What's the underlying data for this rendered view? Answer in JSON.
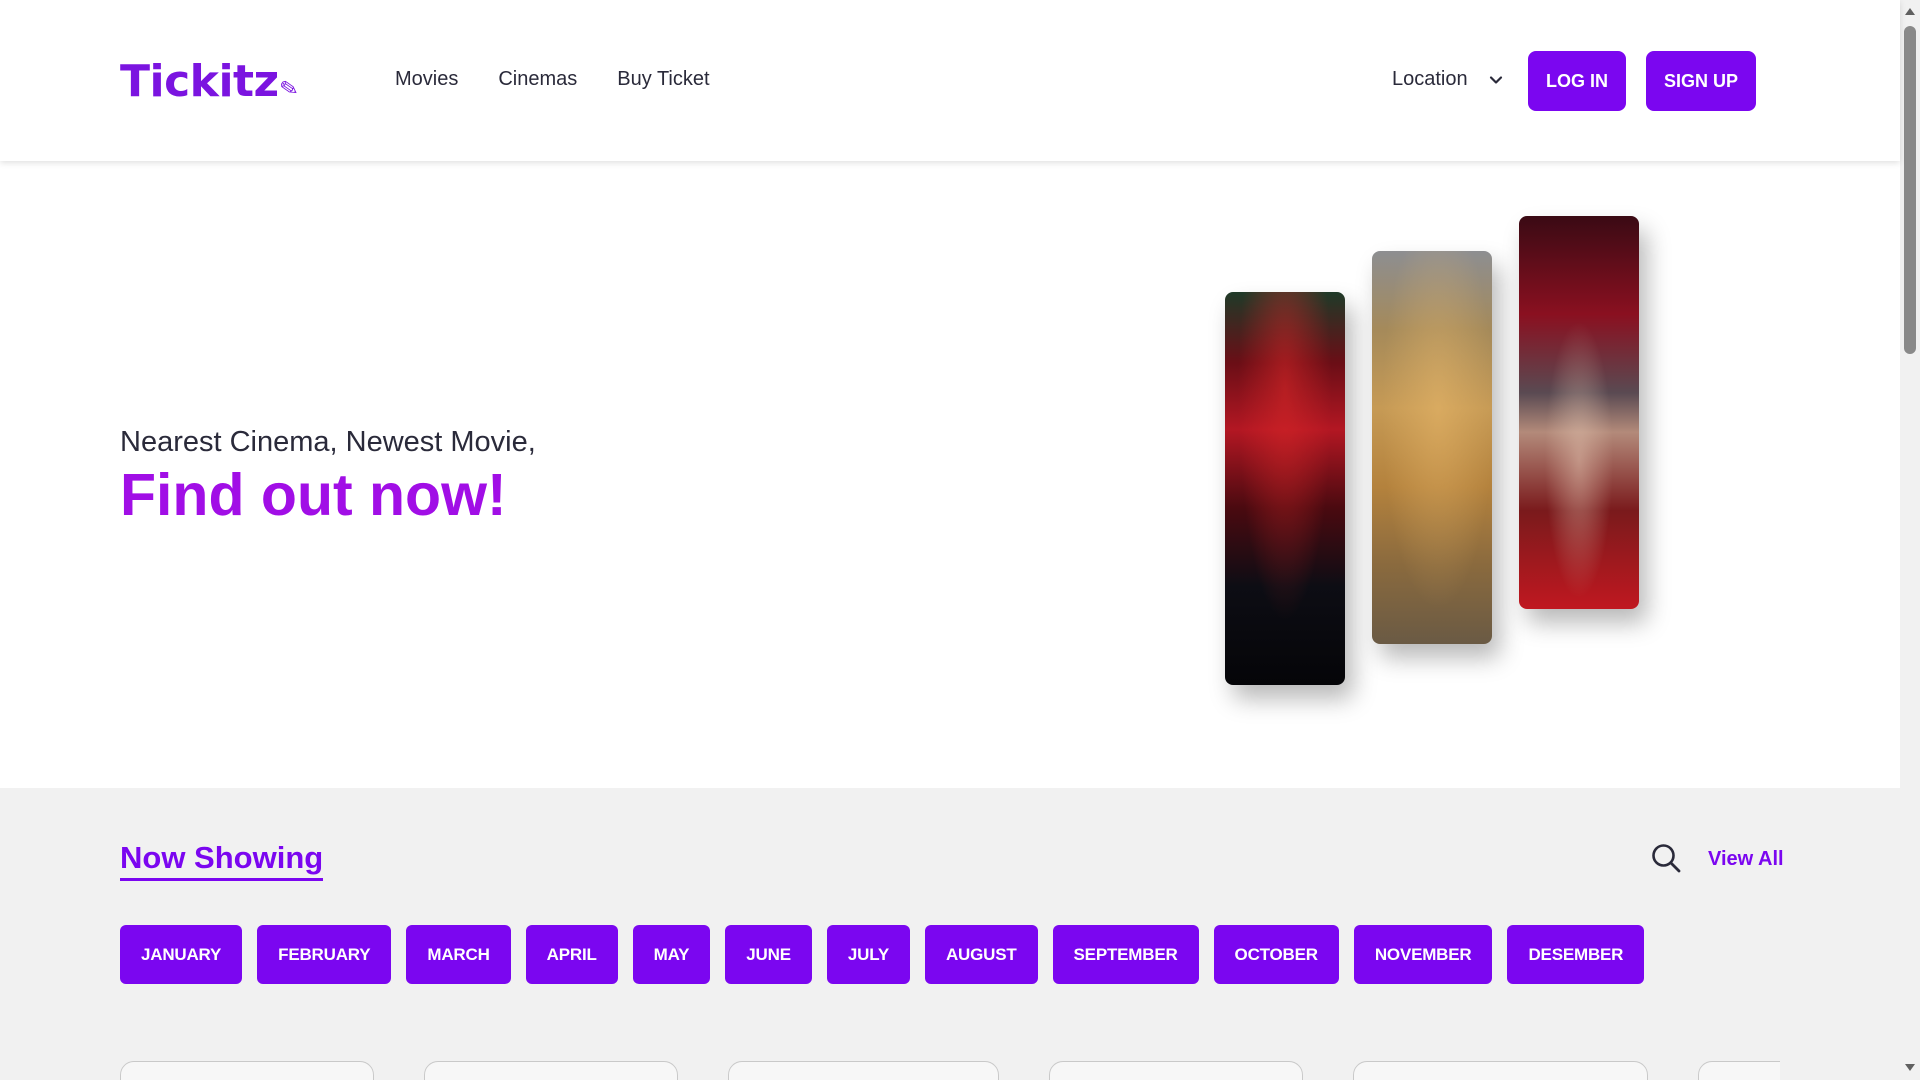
{
  "header": {
    "logo": "Tickitz",
    "nav": [
      "Movies",
      "Cinemas",
      "Buy Ticket"
    ],
    "location_label": "Location",
    "login_label": "LOG IN",
    "signup_label": "SIGN UP"
  },
  "hero": {
    "subtitle": "Nearest Cinema, Newest Movie,",
    "title": "Find out now!"
  },
  "now_showing": {
    "title": "Now Showing",
    "view_all": "View All",
    "months": [
      "JANUARY",
      "FEBRUARY",
      "MARCH",
      "APRIL",
      "MAY",
      "JUNE",
      "JULY",
      "AUGUST",
      "SEPTEMBER",
      "OCTOBER",
      "NOVEMBER",
      "DESEMBER"
    ]
  },
  "colors": {
    "brand": "#7b06f0",
    "hero_title": "#a10ee6",
    "section_bg": "#f1f1f1"
  }
}
